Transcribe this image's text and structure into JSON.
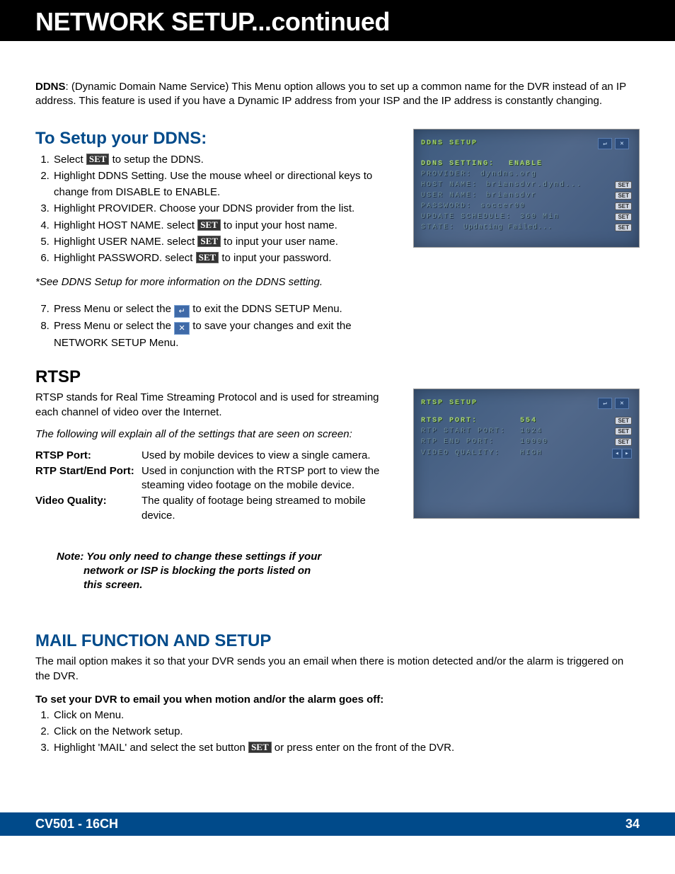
{
  "header": {
    "title": "NETWORK SETUP...continued"
  },
  "ddns": {
    "term": "DDNS",
    "desc": ": (Dynamic Domain Name Service) This Menu option allows you to set up a common name for the DVR instead of an IP address. This feature is used if you have a Dynamic IP address from your ISP and the IP address is constantly changing.",
    "heading": "To Setup your DDNS:",
    "steps": [
      {
        "pre": "Select ",
        "btn": "SET",
        "post": " to setup the DDNS."
      },
      {
        "text": "Highlight DDNS Setting. Use the mouse wheel or directional keys to change from  DISABLE to ENABLE."
      },
      {
        "text": "Highlight PROVIDER. Choose your DDNS provider from the list."
      },
      {
        "pre": "Highlight HOST NAME. select ",
        "btn": "SET",
        "post": " to input your host name."
      },
      {
        "pre": "Highlight USER NAME. select ",
        "btn": "SET",
        "post": " to input your user name."
      },
      {
        "pre": "Highlight PASSWORD. select ",
        "btn": "SET",
        "post": " to input your password."
      }
    ],
    "note": "*See DDNS Setup for more information on the DDNS setting.",
    "steps2": [
      {
        "pre": "Press Menu or select the  ",
        "icon": "↵",
        "post": "  to exit the DDNS SETUP Menu."
      },
      {
        "pre": "Press Menu or select the ",
        "icon": "✕",
        "post": "  to save your changes and exit the NETWORK SETUP Menu."
      }
    ]
  },
  "shot1": {
    "title": "DDNS SETUP",
    "rows": [
      {
        "lbl": "DDNS SETTING:",
        "val": "ENABLE",
        "hl": true
      },
      {
        "lbl": "PROVIDER:",
        "val": "dyndns.org"
      },
      {
        "lbl": "HOST NAME:",
        "val": "briansdvr.dynd...",
        "set": true
      },
      {
        "lbl": "USER NAME:",
        "val": "briansdvr",
        "set": true
      },
      {
        "lbl": "PASSWORD:",
        "val": "soccer00",
        "set": true
      },
      {
        "lbl": "UPDATE SCHEDULE:",
        "val": "360 Min",
        "set": true
      },
      {
        "lbl": "STATE:",
        "val": "Updating Failed...",
        "set": true,
        "state": true
      }
    ]
  },
  "rtsp": {
    "heading": "RTSP",
    "intro": "RTSP stands for Real Time Streaming Protocol and is used for streaming each channel of video over the Internet.",
    "explain": "The following will explain all of the settings that are seen on screen:",
    "defs": [
      {
        "term": "RTSP Port:",
        "desc": "Used by mobile devices to view a single camera."
      },
      {
        "term": "RTP Start/End Port:",
        "desc": "Used in conjunction with the RTSP port to view the steaming video footage on the mobile device."
      },
      {
        "term": "Video Quality:",
        "desc": "The quality of footage being streamed to mobile device."
      }
    ],
    "note": "Note: You only need to change these settings if your",
    "note2": "network or ISP is blocking the ports listed on",
    "note3": "this screen."
  },
  "shot2": {
    "title": "RTSP SETUP",
    "rows": [
      {
        "lbl": "RTSP PORT:",
        "val": "554",
        "set": true,
        "hl": true
      },
      {
        "lbl": "RTP START PORT:",
        "val": "1024",
        "set": true
      },
      {
        "lbl": "RTP END PORT:",
        "val": "10000",
        "set": true
      },
      {
        "lbl": "VIDEO QUALITY:",
        "val": "HIGH",
        "arrows": true
      }
    ]
  },
  "mail": {
    "heading": "MAIL FUNCTION AND SETUP",
    "intro": "The mail option makes it so that your DVR sends you an email when there is motion detected and/or the alarm is triggered on the DVR.",
    "sub": "To set your DVR to email you when motion and/or the alarm goes off:",
    "steps": [
      {
        "text": "Click on Menu."
      },
      {
        "text": "Click on the Network setup."
      },
      {
        "pre": "Highlight 'MAIL' and select the set button  ",
        "btn": "SET",
        "post": " or press enter on the front of the DVR."
      }
    ]
  },
  "footer": {
    "model": "CV501 - 16CH",
    "page": "34"
  },
  "labels": {
    "set": "SET"
  }
}
